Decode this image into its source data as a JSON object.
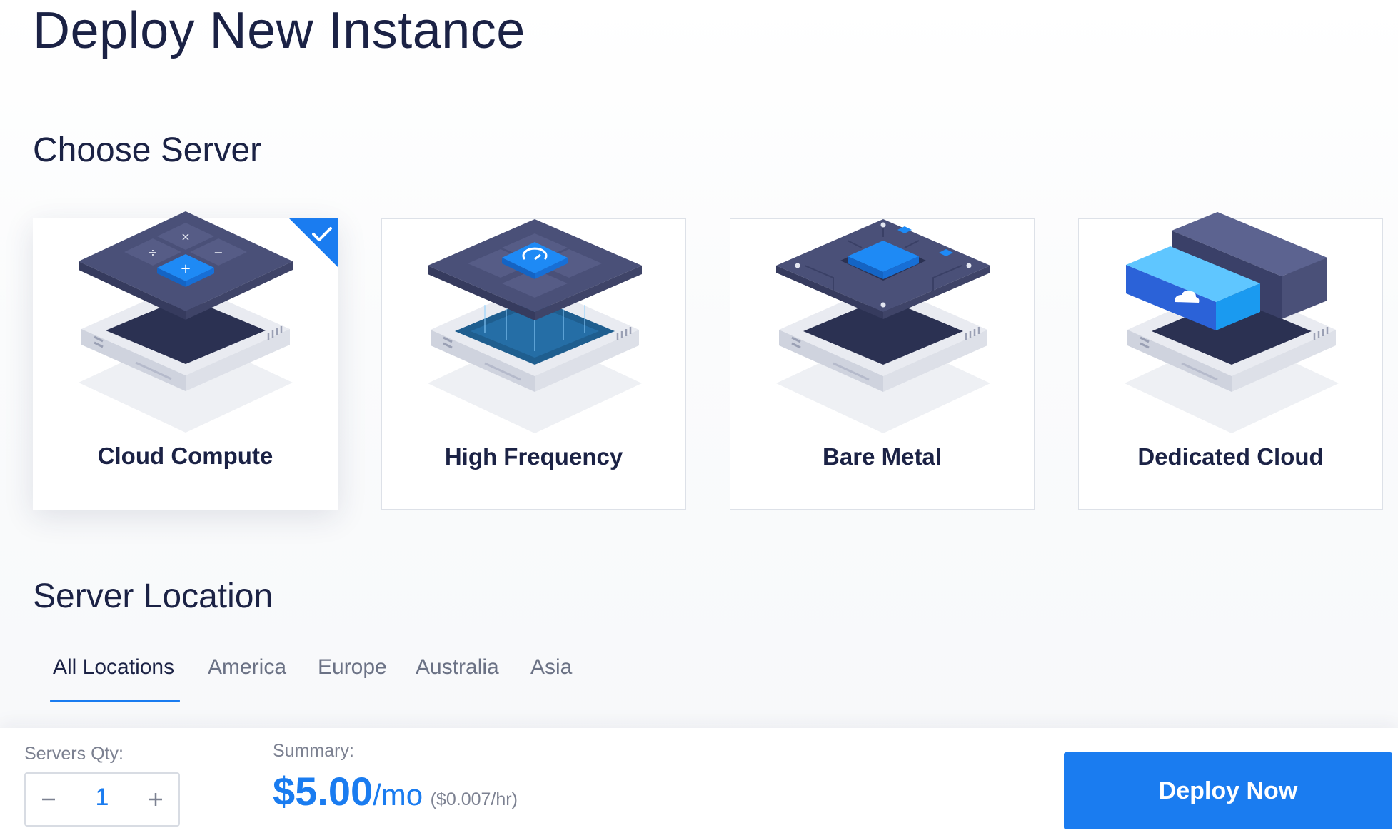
{
  "page": {
    "title": "Deploy New Instance"
  },
  "choose_server": {
    "title": "Choose Server",
    "cards": [
      {
        "label": "Cloud Compute",
        "selected": true,
        "icon": "calculator-chip-icon"
      },
      {
        "label": "High Frequency",
        "selected": false,
        "icon": "speed-chip-icon"
      },
      {
        "label": "Bare Metal",
        "selected": false,
        "icon": "processor-board-icon"
      },
      {
        "label": "Dedicated Cloud",
        "selected": false,
        "icon": "cloud-block-icon"
      }
    ]
  },
  "server_location": {
    "title": "Server Location",
    "tabs": [
      {
        "label": "All Locations",
        "active": true
      },
      {
        "label": "America",
        "active": false
      },
      {
        "label": "Europe",
        "active": false
      },
      {
        "label": "Australia",
        "active": false
      },
      {
        "label": "Asia",
        "active": false
      }
    ]
  },
  "footer": {
    "qty_label": "Servers Qty:",
    "qty_value": "1",
    "summary_label": "Summary:",
    "price": "$5.00",
    "price_unit": "/mo",
    "price_hourly": "($0.007/hr)",
    "deploy_label": "Deploy Now"
  },
  "colors": {
    "accent": "#1a7cf0",
    "heading": "#1b2245",
    "muted": "#7c8191",
    "border": "#dde1e8"
  }
}
